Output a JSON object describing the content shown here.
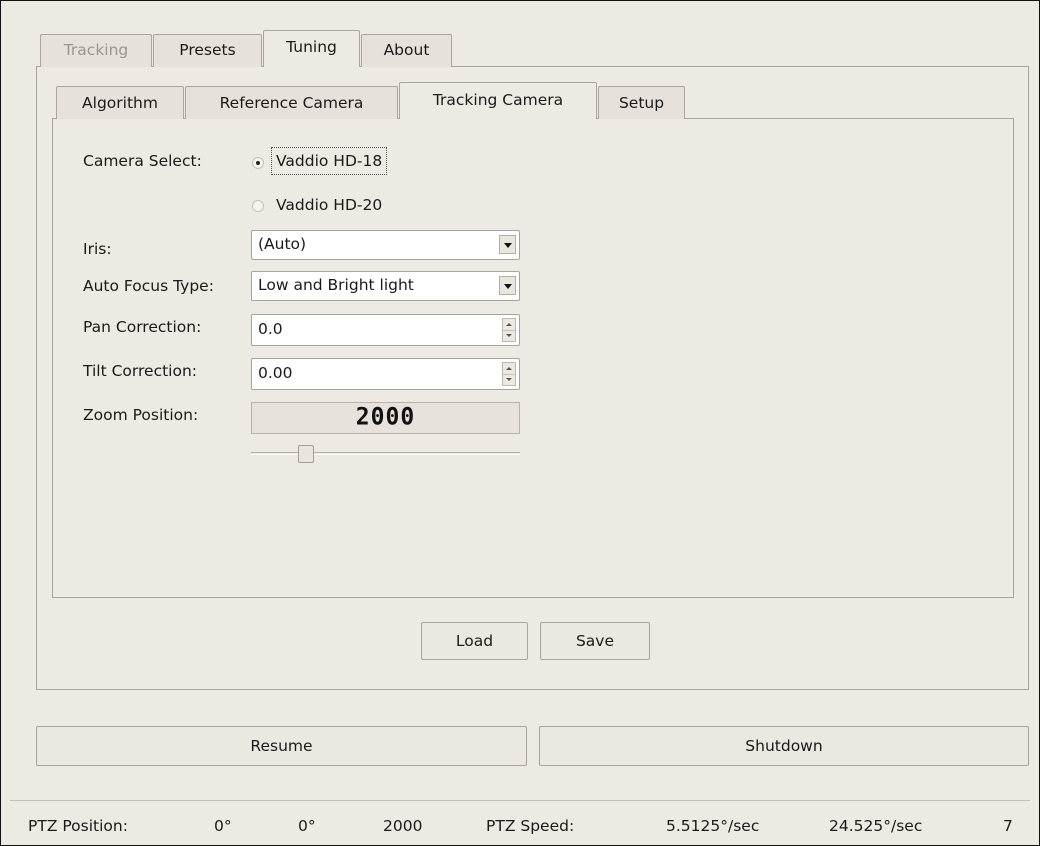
{
  "main_tabs": [
    {
      "label": "Tracking",
      "state": "disabled"
    },
    {
      "label": "Presets",
      "state": "normal"
    },
    {
      "label": "Tuning",
      "state": "active"
    },
    {
      "label": "About",
      "state": "normal"
    }
  ],
  "sub_tabs": [
    {
      "label": "Algorithm"
    },
    {
      "label": "Reference Camera"
    },
    {
      "label": "Tracking Camera",
      "active": true
    },
    {
      "label": "Setup"
    }
  ],
  "form": {
    "camera_select": {
      "label": "Camera Select:",
      "options": [
        {
          "label": "Vaddio HD-18",
          "checked": true
        },
        {
          "label": "Vaddio HD-20",
          "checked": false
        }
      ]
    },
    "iris": {
      "label": "Iris:",
      "value": "(Auto)"
    },
    "auto_focus_type": {
      "label": "Auto Focus Type:",
      "value": "Low and Bright light"
    },
    "pan_correction": {
      "label": "Pan Correction:",
      "value": "0.0"
    },
    "tilt_correction": {
      "label": "Tilt Correction:",
      "value": "0.00"
    },
    "zoom_position": {
      "label": "Zoom Position:",
      "display": "2000",
      "slider_fraction": 0.25
    }
  },
  "buttons": {
    "load": "Load",
    "save": "Save",
    "resume": "Resume",
    "shutdown": "Shutdown"
  },
  "status_bar": {
    "ptz_position_label": "PTZ Position:",
    "pan": "0°",
    "tilt": "0°",
    "zoom": "2000",
    "ptz_speed_label": "PTZ Speed:",
    "pan_speed": "5.5125°/sec",
    "tilt_speed": "24.525°/sec",
    "zoom_speed": "7"
  },
  "colors": {
    "background": "#ede9e3",
    "border": "#a9a49c",
    "field": "#ffffff"
  }
}
